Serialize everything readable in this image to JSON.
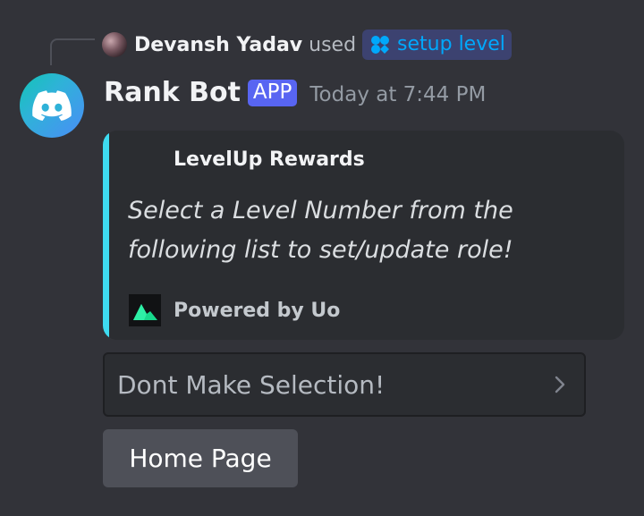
{
  "reply": {
    "user_name": "Devansh Yadav",
    "used_text": "used",
    "command_name": "setup level",
    "command_icon": "bot-command-icon"
  },
  "message": {
    "bot_name": "Rank Bot",
    "app_tag": "APP",
    "timestamp": "Today at 7:44 PM",
    "avatar_icon": "discord-logo-icon"
  },
  "embed": {
    "accent_color": "#3edbf0",
    "author": "LevelUp Rewards",
    "description": "Select a Level Number from the following list to set/update role!",
    "footer_text": "Powered by Uo",
    "footer_icon": "uo-logo-icon"
  },
  "components": {
    "select_placeholder": "Dont Make Selection!",
    "select_icon": "chevron-right-icon",
    "button_label": "Home Page"
  },
  "colors": {
    "background": "#323339",
    "command_link": "#00a8fc",
    "app_tag": "#5865f2"
  }
}
